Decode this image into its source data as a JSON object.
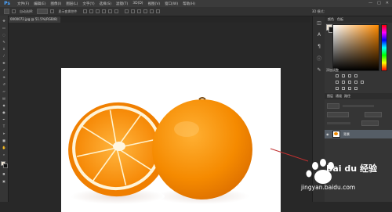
{
  "menubar": {
    "logo": "Ps",
    "items": [
      "文件(F)",
      "编辑(E)",
      "图像(I)",
      "图层(L)",
      "文字(Y)",
      "选择(S)",
      "滤镜(T)",
      "3D(D)",
      "视图(V)",
      "窗口(W)",
      "帮助(H)"
    ],
    "window_buttons": [
      "—",
      "□",
      "✕"
    ]
  },
  "optionsbar": {
    "auto_select_label": "自动选择:",
    "show_transform_label": "显示变换控件",
    "mode_3d_label": "3D 模式:"
  },
  "document": {
    "tab_title": "0000072.jpg @ 51.5%(RGB/8)",
    "tab_close": "×"
  },
  "toolbar": {
    "tools": [
      "move-tool",
      "marquee-tool",
      "lasso-tool",
      "quick-select-tool",
      "crop-tool",
      "eyedropper-tool",
      "healing-tool",
      "brush-tool",
      "clone-tool",
      "history-brush-tool",
      "eraser-tool",
      "gradient-tool",
      "blur-tool",
      "dodge-tool",
      "pen-tool",
      "type-tool",
      "path-select-tool",
      "shape-tool",
      "hand-tool",
      "zoom-tool"
    ]
  },
  "panels": {
    "color_tabs": [
      "颜色",
      "色板"
    ],
    "adjustments_title": "添加调整",
    "layers_tabs": [
      "图层",
      "通道",
      "路径"
    ],
    "layer_name": "背景"
  },
  "watermark": {
    "brand": "Bai du 经验",
    "url": "jingyan.baidu.com"
  },
  "colors": {
    "workspace": "#282828",
    "orange": "#f28b00",
    "arrow": "#c03030"
  }
}
